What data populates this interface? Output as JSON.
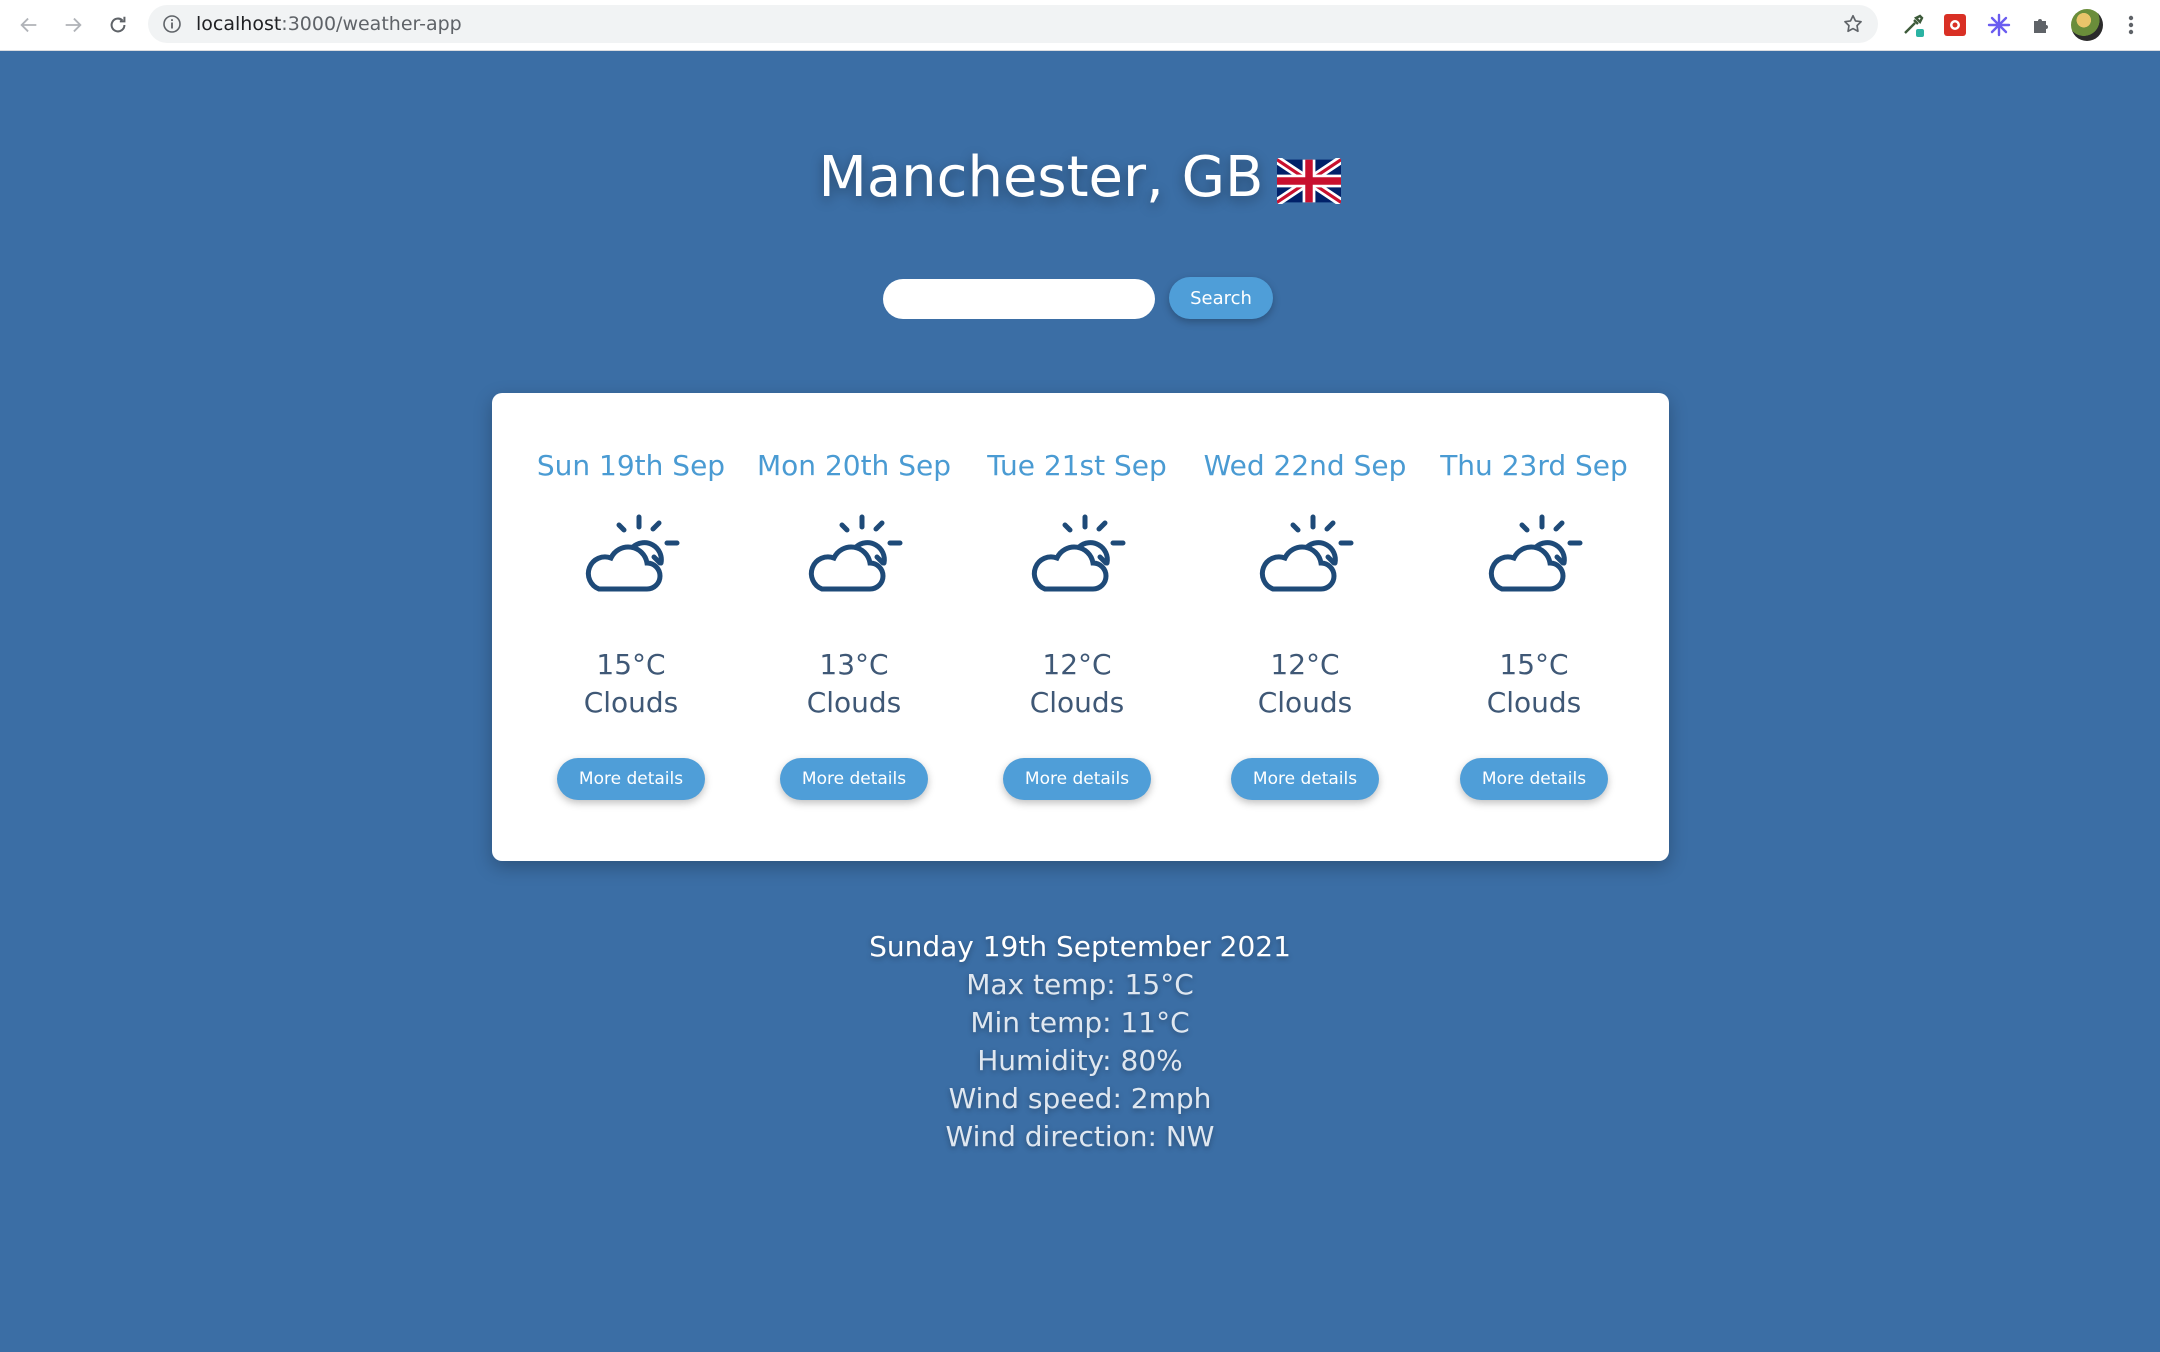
{
  "browser": {
    "url_host": "localhost",
    "url_path": ":3000/weather-app"
  },
  "city": {
    "title": "Manchester, GB",
    "flag": "GB flag"
  },
  "search": {
    "value": "",
    "button_label": "Search"
  },
  "forecast": [
    {
      "date": "Sun 19th Sep",
      "icon": "partly-cloudy-icon",
      "temp": "15°C",
      "desc": "Clouds",
      "button": "More details"
    },
    {
      "date": "Mon 20th Sep",
      "icon": "partly-cloudy-icon",
      "temp": "13°C",
      "desc": "Clouds",
      "button": "More details"
    },
    {
      "date": "Tue 21st Sep",
      "icon": "partly-cloudy-icon",
      "temp": "12°C",
      "desc": "Clouds",
      "button": "More details"
    },
    {
      "date": "Wed 22nd Sep",
      "icon": "partly-cloudy-icon",
      "temp": "12°C",
      "desc": "Clouds",
      "button": "More details"
    },
    {
      "date": "Thu 23rd Sep",
      "icon": "partly-cloudy-icon",
      "temp": "15°C",
      "desc": "Clouds",
      "button": "More details"
    }
  ],
  "details": {
    "date": "Sunday 19th September 2021",
    "max_temp": "Max temp: 15°C",
    "min_temp": "Min temp: 11°C",
    "humidity": "Humidity: 80%",
    "wind_speed": "Wind speed: 2mph",
    "wind_direction": "Wind direction: NW"
  },
  "colors": {
    "background": "#3b6ea5",
    "accent": "#4f9ed8",
    "date_text": "#4a9bd3",
    "body_text": "#3f5876",
    "icon": "#1e4a78"
  }
}
